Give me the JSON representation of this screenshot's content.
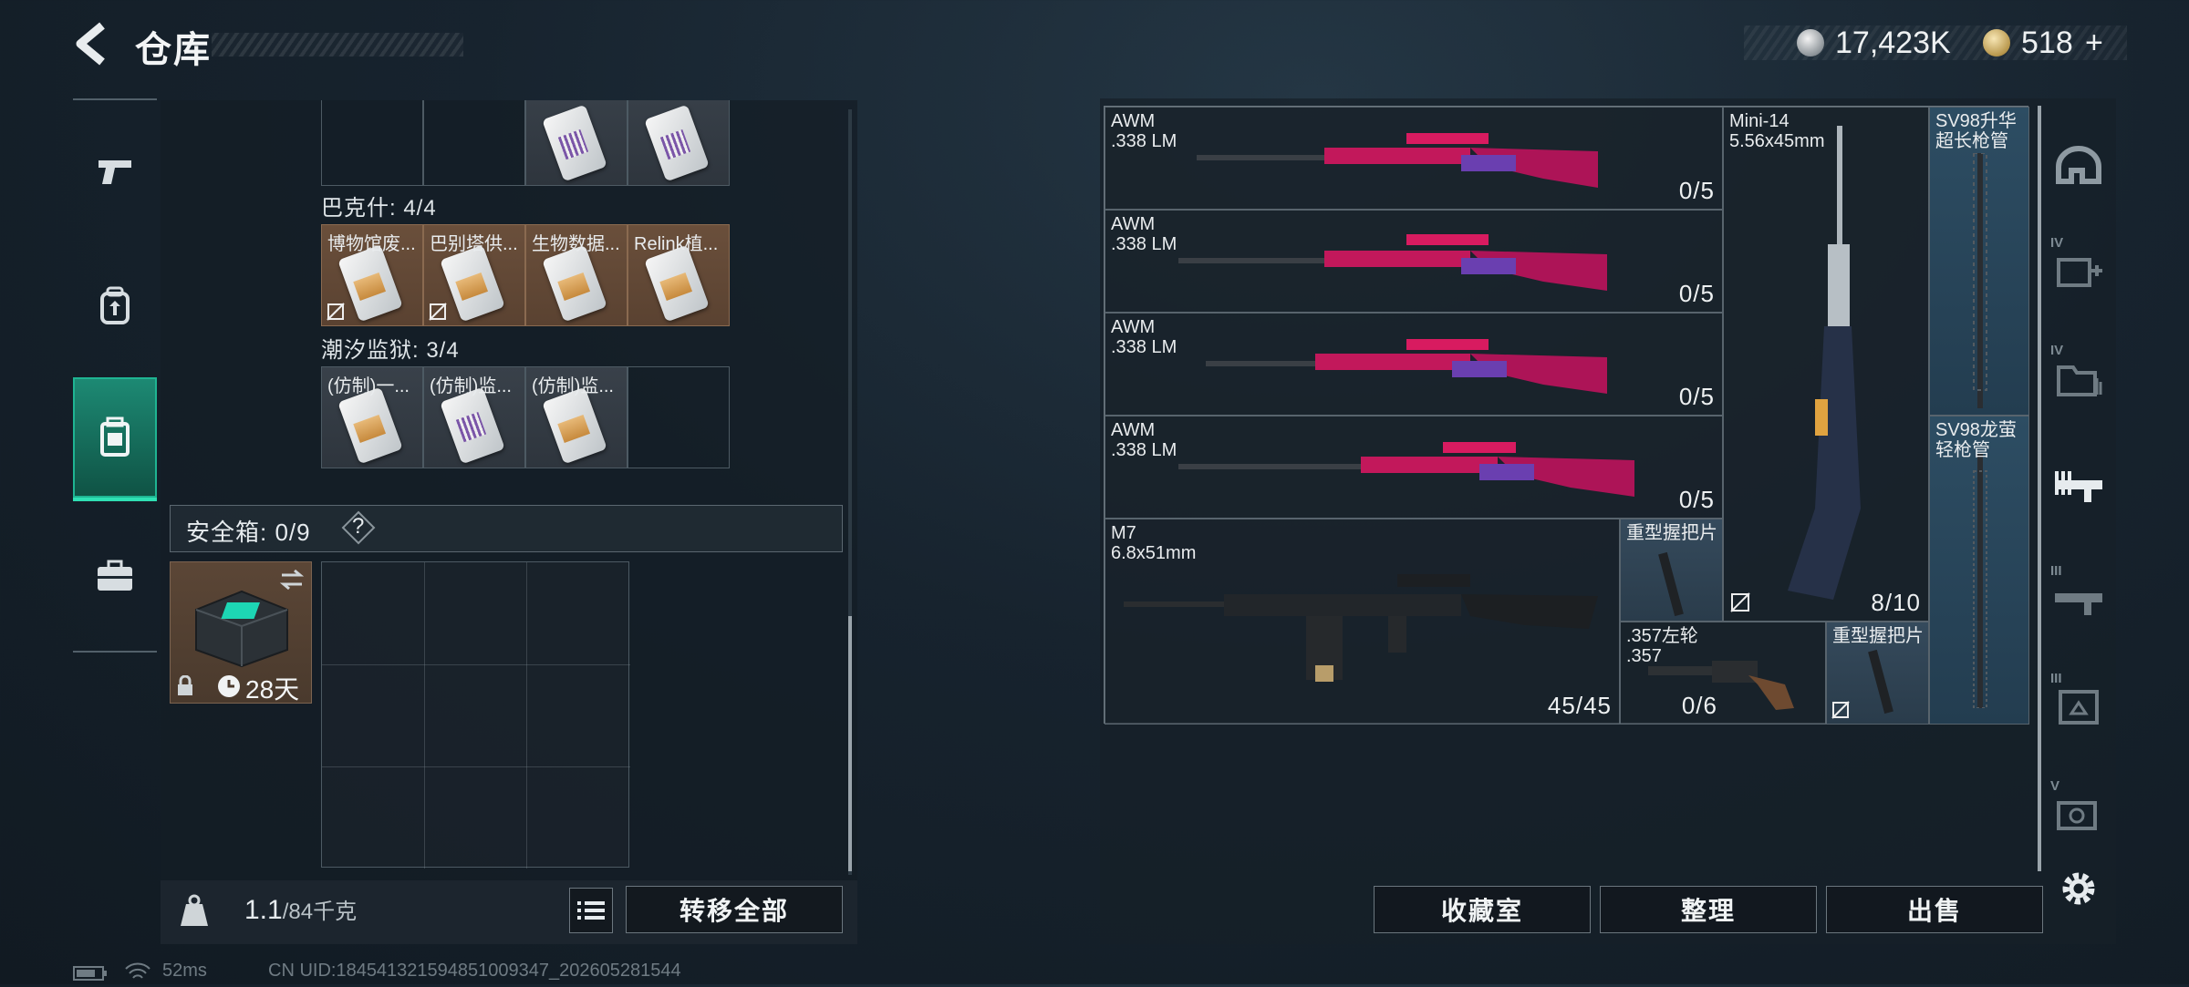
{
  "header": {
    "title": "仓库"
  },
  "currency": {
    "silver": "17,423K",
    "gold": "518",
    "gold_plus": "+"
  },
  "left_tabs": [
    {
      "name": "pistol"
    },
    {
      "name": "backpack"
    },
    {
      "name": "chest-rig"
    },
    {
      "name": "briefcase"
    }
  ],
  "inventory": {
    "top_row": [
      {
        "label": ""
      },
      {
        "label": ""
      },
      {
        "label": ""
      },
      {
        "label": ""
      }
    ],
    "section1": {
      "title": "巴克什: 4/4",
      "items": [
        {
          "label": "博物馆废..."
        },
        {
          "label": "巴别塔供..."
        },
        {
          "label": "生物数据..."
        },
        {
          "label": "Relink植..."
        }
      ]
    },
    "section2": {
      "title": "潮汐监狱: 3/4",
      "items": [
        {
          "label": "(仿制)一..."
        },
        {
          "label": "(仿制)监..."
        },
        {
          "label": "(仿制)监..."
        },
        {
          "label": ""
        }
      ]
    },
    "safebox": {
      "title": "安全箱: 0/9",
      "help": "?"
    },
    "case": {
      "time": "28天"
    }
  },
  "bottom": {
    "weight": "1.1",
    "weight_max": "/84千克",
    "transfer_all": "转移全部"
  },
  "weapons": [
    {
      "name": "AWM\n.338 LM",
      "count": "0/5"
    },
    {
      "name": "AWM\n.338 LM",
      "count": "0/5"
    },
    {
      "name": "AWM\n.338 LM",
      "count": "0/5"
    },
    {
      "name": "AWM\n.338 LM",
      "count": "0/5"
    },
    {
      "name": "M7\n6.8x51mm",
      "count": "45/45"
    },
    {
      "name": "Mini-14\n5.56x45mm",
      "count": "8/10"
    },
    {
      "name": "SV98升华\n超长枪管",
      "count": ""
    },
    {
      "name": "SV98龙萤\n轻枪管",
      "count": ""
    },
    {
      "name": "重型握把片",
      "count": ""
    },
    {
      "name": ".357左轮\n.357",
      "count": "0/6"
    },
    {
      "name": "重型握把片",
      "count": ""
    }
  ],
  "right_tabs": [
    {
      "num": "",
      "name": "helmet"
    },
    {
      "num": "IV",
      "name": "medkit"
    },
    {
      "num": "IV",
      "name": "folder"
    },
    {
      "num": "",
      "name": "rifle"
    },
    {
      "num": "III",
      "name": "rifle-iii"
    },
    {
      "num": "III",
      "name": "armor-iii"
    },
    {
      "num": "V",
      "name": "camera-v"
    }
  ],
  "actions": {
    "collection": "收藏室",
    "sort": "整理",
    "sell": "出售"
  },
  "status": {
    "ping": "52ms",
    "uid": "CN UID:184541321594851009347_202605281544"
  },
  "colors": {
    "accent": "#2fe0b4",
    "brown_tile": "#6a4f3b",
    "blue_tile": "#2d4d63"
  }
}
